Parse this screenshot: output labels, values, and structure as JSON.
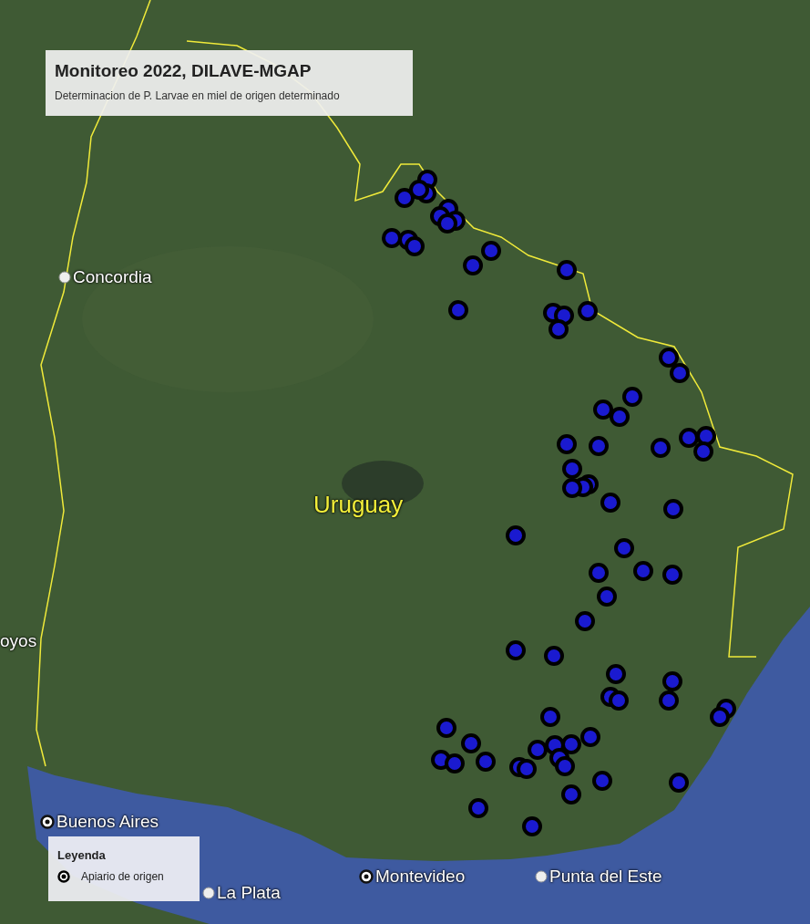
{
  "title_panel": {
    "title": "Monitoreo 2022, DILAVE-MGAP",
    "subtitle": "Determinacion de P. Larvae en miel de origen determinado"
  },
  "places": [
    {
      "name": "Concordia",
      "kind": "town"
    },
    {
      "name": "Uruguay",
      "kind": "country"
    },
    {
      "name": "oyos",
      "kind": "edge"
    },
    {
      "name": "Buenos Aires",
      "kind": "capital"
    },
    {
      "name": "La Plata",
      "kind": "town"
    },
    {
      "name": "Montevideo",
      "kind": "capital"
    },
    {
      "name": "Punta del Este",
      "kind": "town"
    }
  ],
  "legend": {
    "title": "Leyenda",
    "items": [
      {
        "label": "Apiario de origen"
      }
    ]
  }
}
